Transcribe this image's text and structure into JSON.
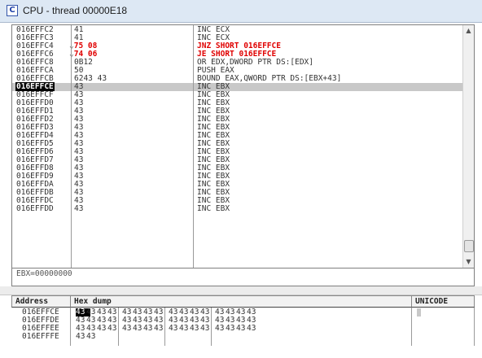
{
  "window": {
    "title": "CPU - thread 00000E18",
    "icon_letter": "C"
  },
  "disasm": {
    "rows": [
      {
        "addr": "016EFFC2",
        "hex": "41",
        "cmd": "INC ECX",
        "jump": false,
        "sel": false,
        "arrow": ""
      },
      {
        "addr": "016EFFC3",
        "hex": "41",
        "cmd": "INC ECX",
        "jump": false,
        "sel": false,
        "arrow": ""
      },
      {
        "addr": "016EFFC4",
        "hex": "75 08",
        "cmd": "JNZ SHORT 016EFFCE",
        "jump": true,
        "sel": false,
        "arrow": "⌄"
      },
      {
        "addr": "016EFFC6",
        "hex": "74 06",
        "cmd": "JE SHORT 016EFFCE",
        "jump": true,
        "sel": false,
        "arrow": "⌄"
      },
      {
        "addr": "016EFFC8",
        "hex": "0B12",
        "cmd": "OR EDX,DWORD PTR DS:[EDX]",
        "jump": false,
        "sel": false,
        "arrow": ""
      },
      {
        "addr": "016EFFCA",
        "hex": "50",
        "cmd": "PUSH EAX",
        "jump": false,
        "sel": false,
        "arrow": ""
      },
      {
        "addr": "016EFFCB",
        "hex": "6243 43",
        "cmd": "BOUND EAX,QWORD PTR DS:[EBX+43]",
        "jump": false,
        "sel": false,
        "arrow": ""
      },
      {
        "addr": "016EFFCE",
        "hex": "43",
        "cmd": "INC EBX",
        "jump": false,
        "sel": true,
        "arrow": ""
      },
      {
        "addr": "016EFFCF",
        "hex": "43",
        "cmd": "INC EBX",
        "jump": false,
        "sel": false,
        "arrow": ""
      },
      {
        "addr": "016EFFD0",
        "hex": "43",
        "cmd": "INC EBX",
        "jump": false,
        "sel": false,
        "arrow": ""
      },
      {
        "addr": "016EFFD1",
        "hex": "43",
        "cmd": "INC EBX",
        "jump": false,
        "sel": false,
        "arrow": ""
      },
      {
        "addr": "016EFFD2",
        "hex": "43",
        "cmd": "INC EBX",
        "jump": false,
        "sel": false,
        "arrow": ""
      },
      {
        "addr": "016EFFD3",
        "hex": "43",
        "cmd": "INC EBX",
        "jump": false,
        "sel": false,
        "arrow": ""
      },
      {
        "addr": "016EFFD4",
        "hex": "43",
        "cmd": "INC EBX",
        "jump": false,
        "sel": false,
        "arrow": ""
      },
      {
        "addr": "016EFFD5",
        "hex": "43",
        "cmd": "INC EBX",
        "jump": false,
        "sel": false,
        "arrow": ""
      },
      {
        "addr": "016EFFD6",
        "hex": "43",
        "cmd": "INC EBX",
        "jump": false,
        "sel": false,
        "arrow": ""
      },
      {
        "addr": "016EFFD7",
        "hex": "43",
        "cmd": "INC EBX",
        "jump": false,
        "sel": false,
        "arrow": ""
      },
      {
        "addr": "016EFFD8",
        "hex": "43",
        "cmd": "INC EBX",
        "jump": false,
        "sel": false,
        "arrow": ""
      },
      {
        "addr": "016EFFD9",
        "hex": "43",
        "cmd": "INC EBX",
        "jump": false,
        "sel": false,
        "arrow": ""
      },
      {
        "addr": "016EFFDA",
        "hex": "43",
        "cmd": "INC EBX",
        "jump": false,
        "sel": false,
        "arrow": ""
      },
      {
        "addr": "016EFFDB",
        "hex": "43",
        "cmd": "INC EBX",
        "jump": false,
        "sel": false,
        "arrow": ""
      },
      {
        "addr": "016EFFDC",
        "hex": "43",
        "cmd": "INC EBX",
        "jump": false,
        "sel": false,
        "arrow": ""
      },
      {
        "addr": "016EFFDD",
        "hex": "43",
        "cmd": "INC EBX",
        "jump": false,
        "sel": false,
        "arrow": ""
      }
    ],
    "scroll_up_icon": "up-arrow",
    "scroll_down_icon": "down-arrow",
    "scroll_position": 0.92
  },
  "info": {
    "text": "EBX=00000000"
  },
  "dump": {
    "headers": {
      "address": "Address",
      "hex": "Hex dump",
      "unicode": "UNICODE"
    },
    "rows": [
      {
        "addr": "016EFFCE",
        "bytes": [
          "43",
          "43",
          "43",
          "43",
          "43",
          "43",
          "43",
          "43",
          "43",
          "43",
          "43",
          "43",
          "43",
          "43",
          "43",
          "43"
        ]
      },
      {
        "addr": "016EFFDE",
        "bytes": [
          "43",
          "43",
          "43",
          "43",
          "43",
          "43",
          "43",
          "43",
          "43",
          "43",
          "43",
          "43",
          "43",
          "43",
          "43",
          "43"
        ]
      },
      {
        "addr": "016EFFEE",
        "bytes": [
          "43",
          "43",
          "43",
          "43",
          "43",
          "43",
          "43",
          "43",
          "43",
          "43",
          "43",
          "43",
          "43",
          "43",
          "43",
          "43"
        ]
      },
      {
        "addr": "016EFFFE",
        "bytes": [
          "43",
          "43"
        ]
      }
    ]
  },
  "colors": {
    "jump": "#e00000",
    "selection": "#c8c8c8",
    "title_bar": "#dde8f4"
  }
}
